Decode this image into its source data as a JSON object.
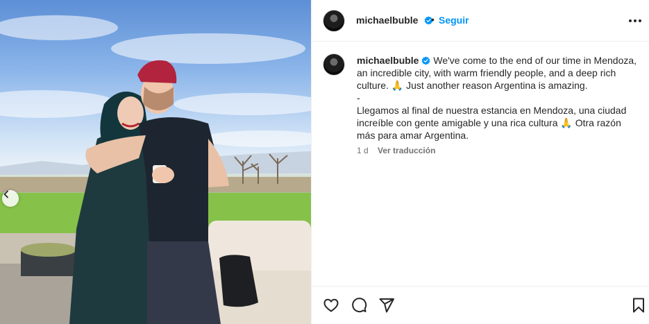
{
  "post": {
    "username": "michaelbuble",
    "follow_label": "Seguir",
    "separator": "•",
    "caption": "We've come to the end of our time in Mendoza, an incredible city, with warm friendly people, and a deep rich culture. 🙏 Just another reason Argentina is amazing.\n-\nLlegamos al final de nuestra estancia en Mendoza, una ciudad increíble con gente amigable y una rica cultura 🙏 Otra razón más para amar Argentina.",
    "timestamp": "1 d",
    "translate_label": "Ver traducción"
  },
  "colors": {
    "follow": "#0095f6",
    "verified": "#0095f6",
    "text": "#262626",
    "muted": "#737373"
  },
  "icons": [
    "chevron-left-icon",
    "verified-badge-icon",
    "more-options-icon",
    "heart-icon",
    "comment-icon",
    "share-icon",
    "bookmark-icon"
  ]
}
